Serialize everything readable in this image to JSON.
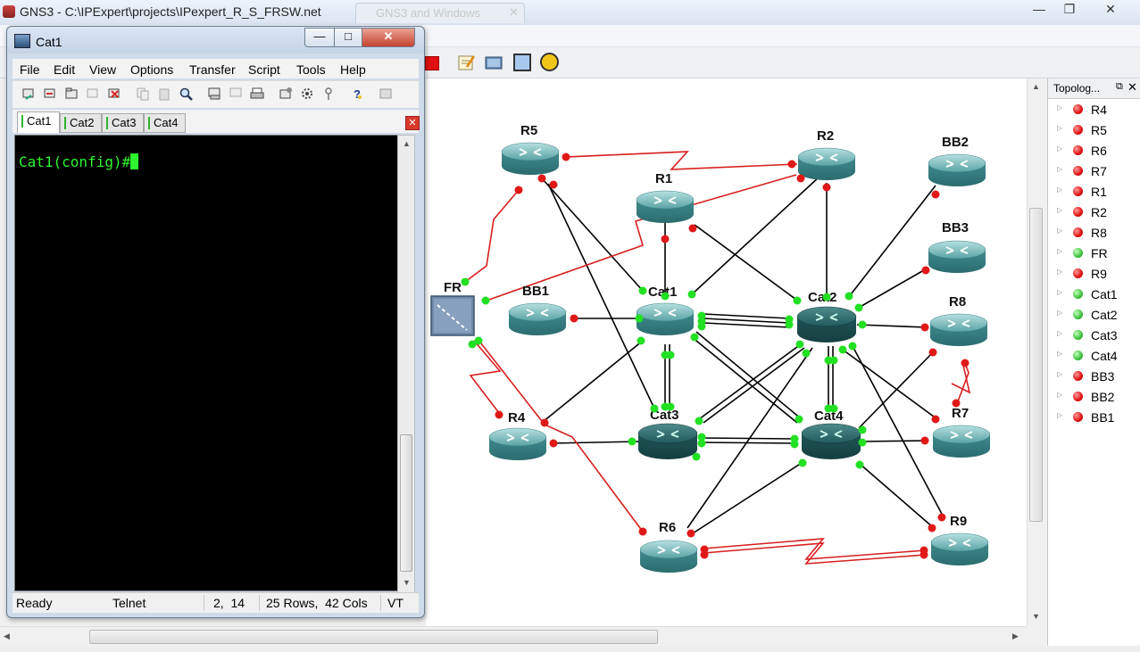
{
  "gns3": {
    "title": "GNS3 - C:\\IPExpert\\projects\\IPexpert_R_S_FRSW.net",
    "background_tab": "GNS3 and Windows",
    "window_buttons": {
      "minimize": "—",
      "maximize": "❐",
      "close": "✕"
    }
  },
  "terminal": {
    "title": "Cat1",
    "menu": [
      "File",
      "Edit",
      "View",
      "Options",
      "Transfer",
      "Script",
      "Tools",
      "Help"
    ],
    "tabs": [
      {
        "label": "Cat1",
        "active": true
      },
      {
        "label": "Cat2",
        "active": false
      },
      {
        "label": "Cat3",
        "active": false
      },
      {
        "label": "Cat4",
        "active": false
      }
    ],
    "prompt": "Cat1(config)#",
    "status": {
      "state": "Ready",
      "protocol": "Telnet",
      "cursor": "2,  14",
      "size": "25 Rows,  42 Cols",
      "emulation": "VT"
    }
  },
  "topology_panel": {
    "title": "Topolog...",
    "items": [
      {
        "label": "R4",
        "status": "red"
      },
      {
        "label": "R5",
        "status": "red"
      },
      {
        "label": "R6",
        "status": "red"
      },
      {
        "label": "R7",
        "status": "red"
      },
      {
        "label": "R1",
        "status": "red"
      },
      {
        "label": "R2",
        "status": "red"
      },
      {
        "label": "R8",
        "status": "red"
      },
      {
        "label": "FR",
        "status": "green"
      },
      {
        "label": "R9",
        "status": "red"
      },
      {
        "label": "Cat1",
        "status": "green"
      },
      {
        "label": "Cat2",
        "status": "green"
      },
      {
        "label": "Cat3",
        "status": "green"
      },
      {
        "label": "Cat4",
        "status": "green"
      },
      {
        "label": "BB3",
        "status": "red"
      },
      {
        "label": "BB2",
        "status": "red"
      },
      {
        "label": "BB1",
        "status": "red"
      }
    ]
  },
  "nodes": {
    "R5": "R5",
    "R2": "R2",
    "BB2": "BB2",
    "R1": "R1",
    "BB3": "BB3",
    "FR": "FR",
    "BB1": "BB1",
    "Cat1": "Cat1",
    "Cat2": "Cat2",
    "R8": "R8",
    "Cat3": "Cat3",
    "Cat4": "Cat4",
    "R4": "R4",
    "R7": "R7",
    "R6": "R6",
    "R9": "R9"
  },
  "colors": {
    "link": "#000000",
    "serial_link": "#d81e1e",
    "port_up": "#22e022",
    "port_down": "#e01818",
    "terminal_text": "#2ef52e"
  }
}
